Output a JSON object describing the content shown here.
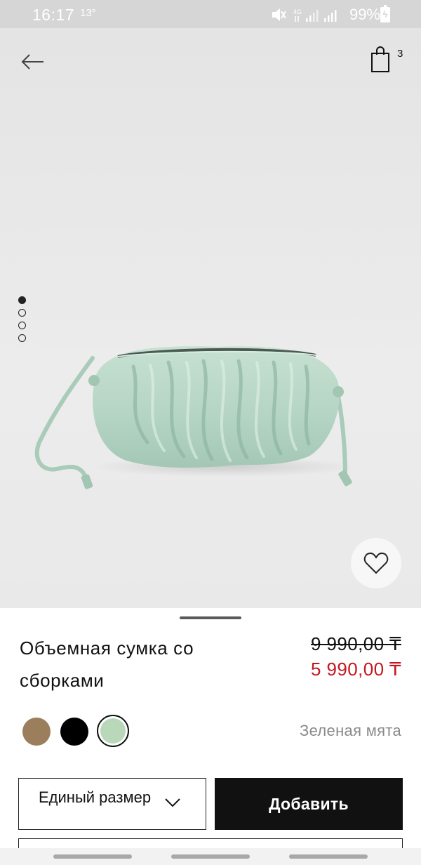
{
  "status_bar": {
    "time": "16:17",
    "temperature": "13°",
    "battery": "99%"
  },
  "header": {
    "cart_count": "3"
  },
  "gallery": {
    "pages": 4,
    "active_page": 1
  },
  "product": {
    "name": "Объемная сумка со сборками",
    "price_old": "9 990,00 ₸",
    "price_new": "5 990,00 ₸"
  },
  "colors": {
    "options": [
      {
        "name": "brown",
        "hex": "#9b7f5d"
      },
      {
        "name": "black",
        "hex": "#000000"
      },
      {
        "name": "mint",
        "hex": "#b9d7b9"
      }
    ],
    "selected_label": "Зеленая мята"
  },
  "actions": {
    "size_label": "Единый размер",
    "add_label": "Добавить"
  },
  "theme": {
    "accent_sale": "#c4171f",
    "button_dark": "#111111"
  }
}
